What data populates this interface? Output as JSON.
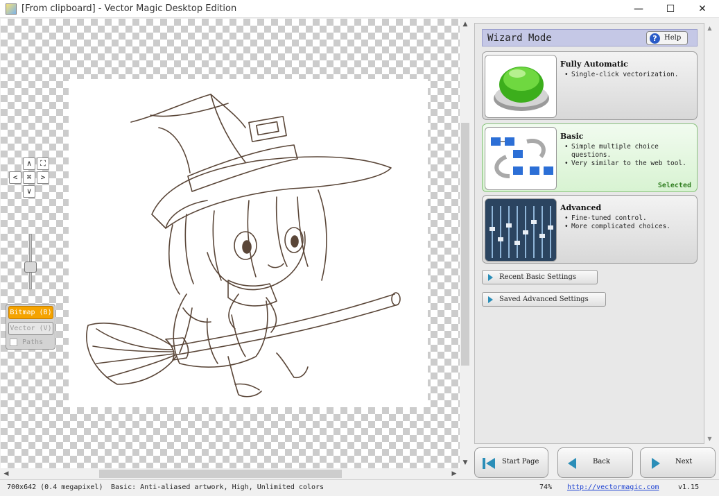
{
  "window": {
    "title": "[From clipboard] - Vector Magic Desktop Edition",
    "minimize": "—",
    "maximize": "☐",
    "close": "✕"
  },
  "canvas_controls": {
    "pan_up": "∧",
    "pan_down": "∨",
    "pan_left": "<",
    "pan_right": ">",
    "center": "⌘",
    "fit": "⛶",
    "zoom_level_fraction": 0.6
  },
  "view_modes": {
    "bitmap": "Bitmap (B)",
    "vector": "Vector (V)",
    "paths": "Paths",
    "paths_checked": false
  },
  "wizard": {
    "title": "Wizard Mode",
    "help": "Help",
    "modes": [
      {
        "title": "Fully Automatic",
        "bullets": [
          "Single-click vectorization."
        ],
        "selected": false
      },
      {
        "title": "Basic",
        "bullets": [
          "Simple multiple choice questions.",
          "Very similar to the web tool."
        ],
        "selected": true
      },
      {
        "title": "Advanced",
        "bullets": [
          "Fine-tuned control.",
          "More complicated choices."
        ],
        "selected": false
      }
    ],
    "selected_label": "Selected",
    "recent_basic": "Recent Basic Settings",
    "saved_advanced": "Saved Advanced Settings"
  },
  "nav": {
    "start_page": "Start Page",
    "back": "Back",
    "next": "Next"
  },
  "status": {
    "image_info": "700x642 (0.4 megapixel)",
    "settings": "Basic: Anti-aliased artwork, High, Unlimited colors",
    "zoom": "74%",
    "url": "http://vectormagic.com",
    "version": "v1.15"
  },
  "colors": {
    "bitmap_active": "#f5a300",
    "wizard_header": "#c5c8e6",
    "selected_green": "#2f7d1f",
    "accent_teal": "#2b8eb8"
  }
}
